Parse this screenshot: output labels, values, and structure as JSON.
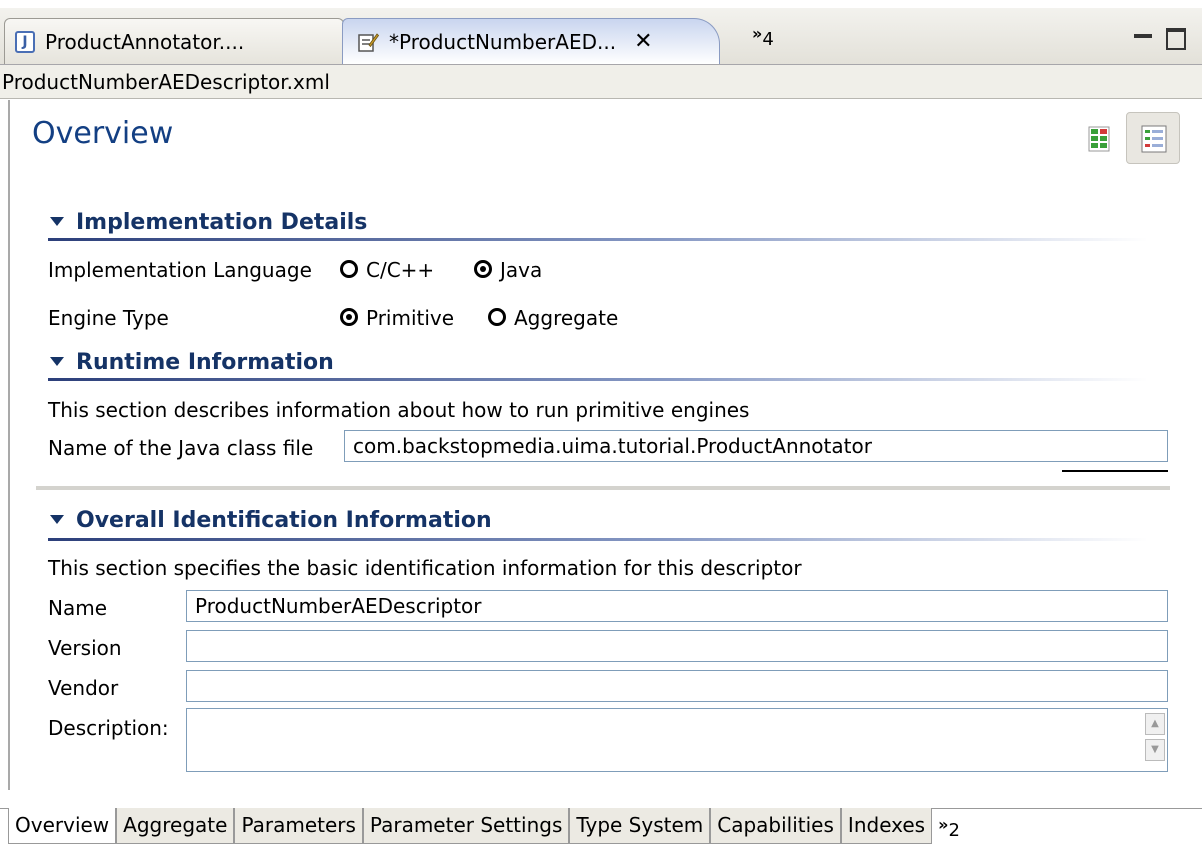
{
  "editor_tabs": [
    {
      "label": "ProductAnnotator....",
      "icon": "java-file-icon"
    },
    {
      "label": "*ProductNumberAED...",
      "icon": "xml-editor-icon",
      "close": "✕"
    }
  ],
  "tab_overflow": {
    "glyph": "»",
    "count": "4"
  },
  "file_name": "ProductNumberAEDescriptor.xml",
  "page_title": "Overview",
  "implementation": {
    "heading": "Implementation Details",
    "language_label": "Implementation Language",
    "language_options": [
      "C/C++",
      "Java"
    ],
    "language_selected": "Java",
    "engine_label": "Engine Type",
    "engine_options": [
      "Primitive",
      "Aggregate"
    ],
    "engine_selected": "Primitive"
  },
  "runtime": {
    "heading": "Runtime Information",
    "description": "This section describes information about how to run primitive engines",
    "class_label": "Name of the Java class file",
    "class_value": "com.backstopmedia.uima.tutorial.ProductAnnotator"
  },
  "identification": {
    "heading": "Overall Identification Information",
    "description": "This section specifies the basic identification information for this descriptor",
    "name_label": "Name",
    "name_value": "ProductNumberAEDescriptor",
    "version_label": "Version",
    "version_value": "",
    "vendor_label": "Vendor",
    "vendor_value": "",
    "description_label": "Description:",
    "description_value": ""
  },
  "bottom_tabs": [
    "Overview",
    "Aggregate",
    "Parameters",
    "Parameter Settings",
    "Type System",
    "Capabilities",
    "Indexes"
  ],
  "bottom_overflow": {
    "glyph": "»",
    "count": "2"
  },
  "colors": {
    "title": "#133f83",
    "section_heading": "#153366",
    "field_border": "#7f9db9"
  }
}
